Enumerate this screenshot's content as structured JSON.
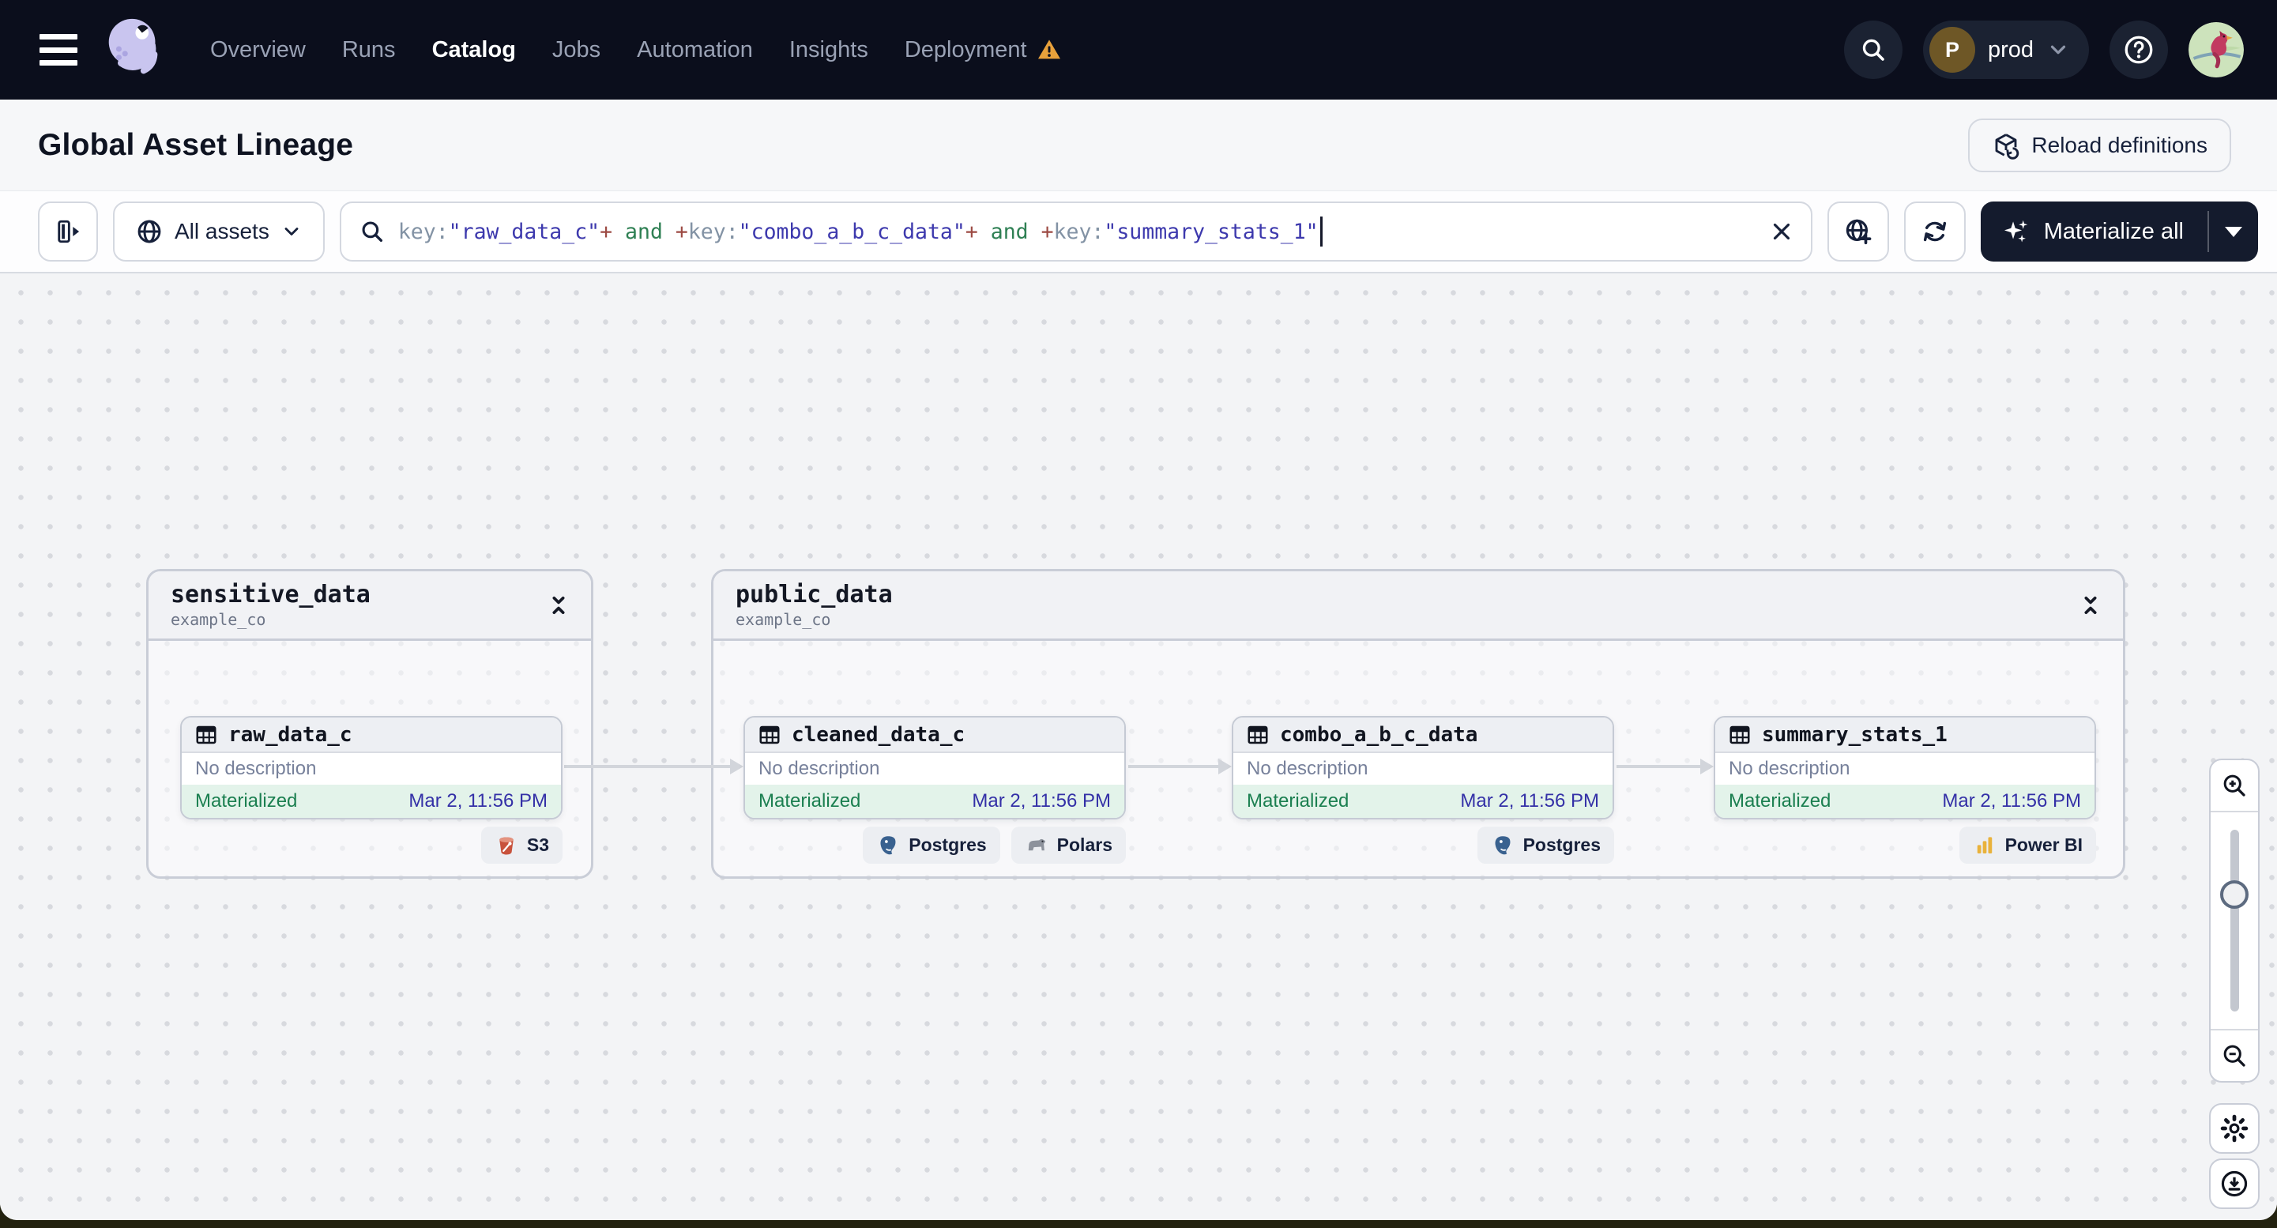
{
  "nav": {
    "items": [
      "Overview",
      "Runs",
      "Catalog",
      "Jobs",
      "Automation",
      "Insights",
      "Deployment"
    ],
    "active_item": "Catalog",
    "env": {
      "initial": "P",
      "label": "prod"
    }
  },
  "page": {
    "title": "Global Asset Lineage",
    "reload_button": "Reload definitions"
  },
  "toolbar": {
    "scope_label": "All assets",
    "materialize_label": "Materialize all",
    "query": {
      "full_text": "key:\"raw_data_c\"+ and +key:\"combo_a_b_c_data\"+ and +key:\"summary_stats_1\"",
      "segments": [
        {
          "type": "key",
          "text": "key:"
        },
        {
          "type": "string",
          "text": "\"raw_data_c\""
        },
        {
          "type": "operator",
          "text": "+"
        },
        {
          "type": "keyword",
          "text": " and "
        },
        {
          "type": "operator",
          "text": "+"
        },
        {
          "type": "key",
          "text": "key:"
        },
        {
          "type": "string",
          "text": "\"combo_a_b_c_data\""
        },
        {
          "type": "operator",
          "text": "+"
        },
        {
          "type": "keyword",
          "text": " and "
        },
        {
          "type": "operator",
          "text": "+"
        },
        {
          "type": "key",
          "text": "key:"
        },
        {
          "type": "string",
          "text": "\"summary_stats_1\""
        }
      ]
    }
  },
  "graph": {
    "groups": [
      {
        "name": "sensitive_data",
        "location": "example_co"
      },
      {
        "name": "public_data",
        "location": "example_co"
      }
    ],
    "assets": [
      {
        "name": "raw_data_c",
        "description": "No description",
        "status": "Materialized",
        "timestamp": "Mar 2, 11:56 PM",
        "tags": [
          {
            "name": "S3"
          }
        ]
      },
      {
        "name": "cleaned_data_c",
        "description": "No description",
        "status": "Materialized",
        "timestamp": "Mar 2, 11:56 PM",
        "tags": [
          {
            "name": "Postgres"
          },
          {
            "name": "Polars"
          }
        ]
      },
      {
        "name": "combo_a_b_c_data",
        "description": "No description",
        "status": "Materialized",
        "timestamp": "Mar 2, 11:56 PM",
        "tags": [
          {
            "name": "Postgres"
          }
        ]
      },
      {
        "name": "summary_stats_1",
        "description": "No description",
        "status": "Materialized",
        "timestamp": "Mar 2, 11:56 PM",
        "tags": [
          {
            "name": "Power BI"
          }
        ]
      }
    ]
  },
  "colors": {
    "nav_bg": "#0b0e1c",
    "status_green": "#1b7f50",
    "status_bg": "#e3f3ea",
    "timestamp_blue": "#3430a7",
    "warning_orange": "#e9a13b",
    "string_indigo": "#3d39ad",
    "keyword_green": "#2f8054",
    "operator_maroon": "#9c4a43"
  }
}
